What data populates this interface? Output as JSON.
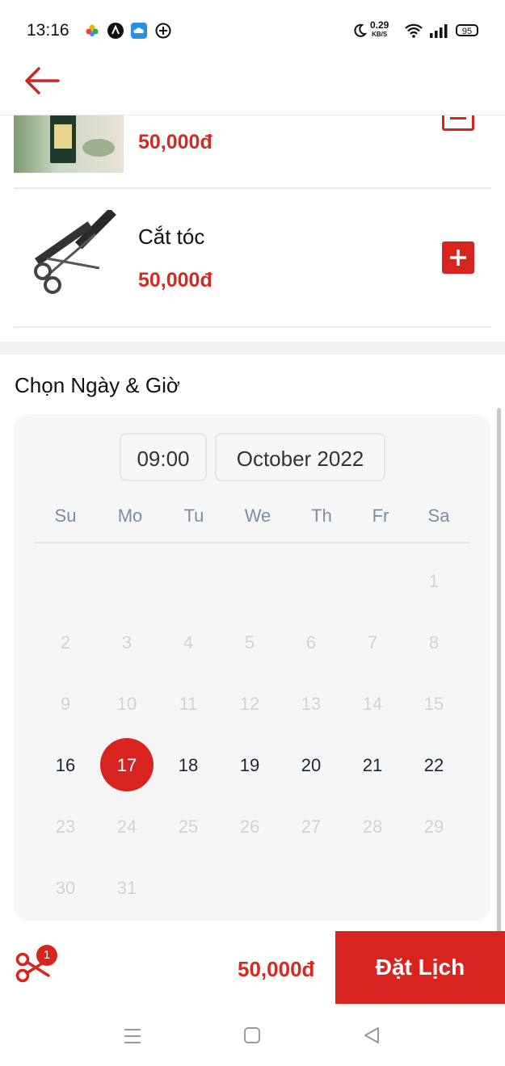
{
  "status_bar": {
    "time": "13:16",
    "net_speed_value": "0.29",
    "net_speed_unit": "KB/S",
    "battery": "95",
    "icons": [
      "pinwheel-icon",
      "app-a-icon",
      "cloud-app-icon",
      "plus-circle-icon",
      "moon-icon",
      "wifi-icon",
      "signal-icon",
      "battery-icon"
    ]
  },
  "header": {
    "back_icon": "arrow-left-icon"
  },
  "services": [
    {
      "name": "",
      "price": "50,000đ",
      "action": "remove",
      "image": "product-photo"
    },
    {
      "name": "Cắt tóc",
      "price": "50,000đ",
      "action": "add",
      "image": "scissors-comb"
    }
  ],
  "section_title": "Chọn Ngày & Giờ",
  "calendar": {
    "time_value": "09:00",
    "month_value": "October 2022",
    "weekdays": [
      "Su",
      "Mo",
      "Tu",
      "We",
      "Th",
      "Fr",
      "Sa"
    ],
    "selected_day": "17",
    "days": [
      "1",
      "2",
      "3",
      "4",
      "5",
      "6",
      "7",
      "8",
      "9",
      "10",
      "11",
      "12",
      "13",
      "14",
      "15",
      "16",
      "17",
      "18",
      "19",
      "20",
      "21",
      "22",
      "23",
      "24",
      "25",
      "26",
      "27",
      "28",
      "29",
      "30",
      "31"
    ]
  },
  "footer": {
    "cart_count": "1",
    "total": "50,000đ",
    "book_label": "Đặt Lịch"
  },
  "colors": {
    "accent": "#d8241f",
    "price": "#d42a22",
    "muted_day": "#cfd4d8",
    "weekday": "#7a8ea3"
  }
}
